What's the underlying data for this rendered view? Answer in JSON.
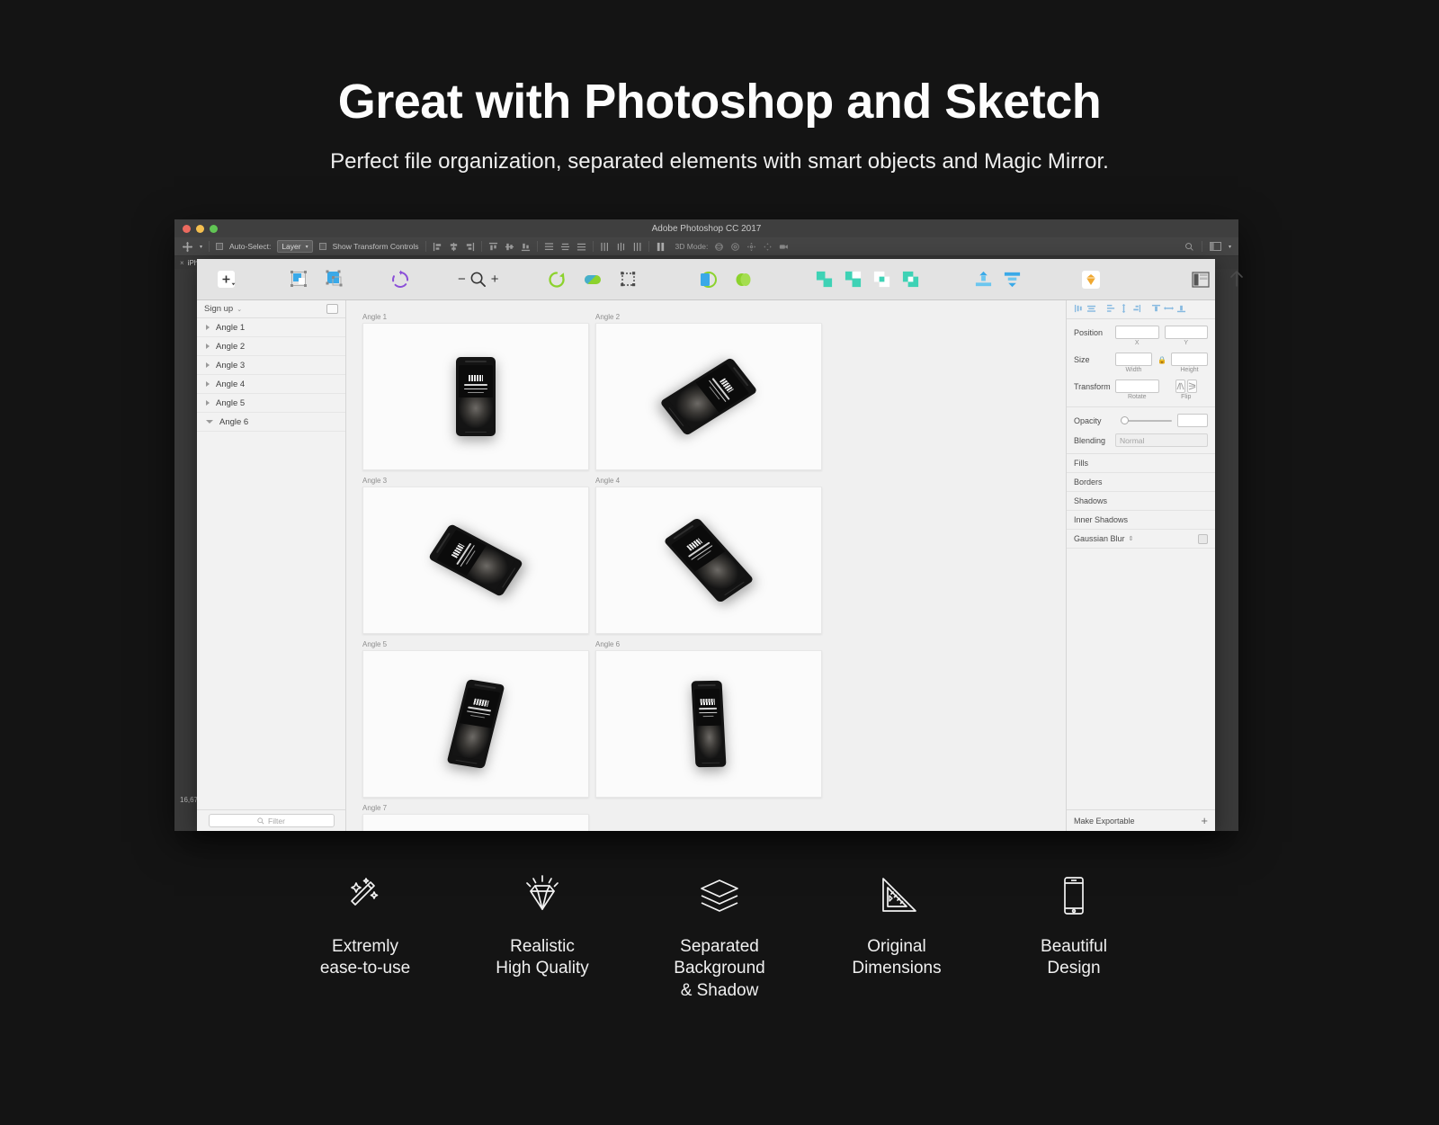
{
  "hero": {
    "title": "Great with Photoshop and Sketch",
    "subtitle": "Perfect file organization, separated elements with smart objects and Magic Mirror."
  },
  "photoshop": {
    "window_title": "Adobe Photoshop CC 2017",
    "options": {
      "move_tool": "move-tool",
      "auto_select_label": "Auto-Select:",
      "auto_select_value": "Layer",
      "show_transform_label": "Show Transform Controls",
      "mode_3d_label": "3D Mode:"
    },
    "tab_label": "iPh",
    "zoom_level": "16,67"
  },
  "sketch": {
    "toolbar": [
      {
        "name": "insert-icon",
        "label": "Insert"
      },
      {
        "name": "scale-icon",
        "label": "Scale"
      },
      {
        "name": "resize-icon",
        "label": "Resize"
      },
      {
        "name": "rotate-copies-icon",
        "label": "Rotate Copies"
      },
      {
        "name": "zoom-out-icon",
        "label": "Zoom Out"
      },
      {
        "name": "zoom-icon",
        "label": "Zoom"
      },
      {
        "name": "zoom-in-icon",
        "label": "Zoom In"
      },
      {
        "name": "rotate-icon",
        "label": "Rotate"
      },
      {
        "name": "flatten-icon",
        "label": "Flatten"
      },
      {
        "name": "transform-icon",
        "label": "Transform"
      },
      {
        "name": "mask-icon",
        "label": "Mask"
      },
      {
        "name": "scissors-icon",
        "label": "Scissors"
      },
      {
        "name": "union-icon",
        "label": "Union"
      },
      {
        "name": "subtract-icon",
        "label": "Subtract"
      },
      {
        "name": "intersect-icon",
        "label": "Intersect"
      },
      {
        "name": "difference-icon",
        "label": "Difference"
      },
      {
        "name": "group-icon",
        "label": "Group"
      },
      {
        "name": "ungroup-icon",
        "label": "Ungroup"
      },
      {
        "name": "sketch-cloud-icon",
        "label": "Sketch Cloud"
      },
      {
        "name": "toggle-layout-icon",
        "label": "Toggle Layout"
      },
      {
        "name": "export-icon",
        "label": "Export"
      }
    ],
    "layers_panel": {
      "page_name": "Sign up",
      "items": [
        {
          "label": "Angle 1",
          "expanded": false
        },
        {
          "label": "Angle 2",
          "expanded": false
        },
        {
          "label": "Angle 3",
          "expanded": false
        },
        {
          "label": "Angle 4",
          "expanded": false
        },
        {
          "label": "Angle 5",
          "expanded": false
        },
        {
          "label": "Angle 6",
          "expanded": true
        }
      ],
      "filter_placeholder": "Filter"
    },
    "canvas": {
      "artboards": [
        {
          "label": "Angle 1",
          "pose": "front"
        },
        {
          "label": "Angle 2",
          "pose": "tilt-right"
        },
        {
          "label": "Angle 3",
          "pose": "tilt-left"
        },
        {
          "label": "Angle 4",
          "pose": "diag-left"
        },
        {
          "label": "Angle 5",
          "pose": "diag-right"
        },
        {
          "label": "Angle 6",
          "pose": "upright-slim"
        },
        {
          "label": "Angle 7",
          "pose": "landscape"
        }
      ],
      "mockup_text": {
        "heading": "Google Pixel 2",
        "line1": "Carefully Crafted Mockups",
        "line2": "for Your Next Project",
        "line3": "Works with Photoshop and Sketch"
      }
    },
    "inspector": {
      "position_label": "Position",
      "position_x_sub": "X",
      "position_y_sub": "Y",
      "position_x_value": "",
      "position_y_value": "",
      "size_label": "Size",
      "size_width_sub": "Width",
      "size_height_sub": "Height",
      "size_width_value": "",
      "size_height_value": "",
      "transform_label": "Transform",
      "rotate_sub": "Rotate",
      "rotate_value": "",
      "flip_sub": "Flip",
      "opacity_label": "Opacity",
      "opacity_value": "",
      "blending_label": "Blending",
      "blending_value": "Normal",
      "sections": [
        {
          "label": "Fills"
        },
        {
          "label": "Borders"
        },
        {
          "label": "Shadows"
        },
        {
          "label": "Inner Shadows"
        },
        {
          "label": "Gaussian Blur"
        }
      ],
      "make_exportable": "Make Exportable"
    }
  },
  "features": [
    {
      "icon": "magic-wand-icon",
      "line1": "Extremly",
      "line2": "ease-to-use",
      "line3": ""
    },
    {
      "icon": "diamond-icon",
      "line1": "Realistic",
      "line2": "High Quality",
      "line3": ""
    },
    {
      "icon": "layers-icon",
      "line1": "Separated",
      "line2": "Background",
      "line3": "& Shadow"
    },
    {
      "icon": "ruler-triangle-icon",
      "line1": "Original",
      "line2": "Dimensions",
      "line3": ""
    },
    {
      "icon": "smartphone-icon",
      "line1": "Beautiful",
      "line2": "Design",
      "line3": ""
    }
  ],
  "colors": {
    "background": "#141414",
    "accent_green": "#8cd22d",
    "accent_blue": "#3aa9e8",
    "accent_teal": "#3ed2b5",
    "accent_orange": "#f0a830"
  }
}
